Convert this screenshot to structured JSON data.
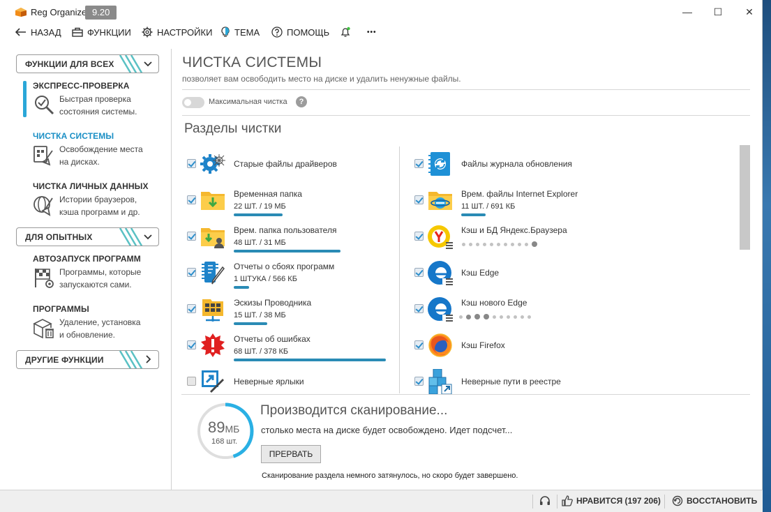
{
  "window": {
    "app_title": "Reg Organizer",
    "version": "9.20",
    "controls": {
      "minimize": "—",
      "maximize": "☐",
      "close": "✕"
    }
  },
  "menu": {
    "back": "НАЗАД",
    "functions": "ФУНКЦИИ",
    "settings": "НАСТРОЙКИ",
    "theme": "ТЕМА",
    "help": "ПОМОЩЬ",
    "more": "•••"
  },
  "sidebar": {
    "groups": [
      {
        "label": "ФУНКЦИИ ДЛЯ ВСЕХ"
      },
      {
        "label": "ДЛЯ ОПЫТНЫХ"
      },
      {
        "label": "ДРУГИЕ ФУНКЦИИ"
      }
    ],
    "items": [
      {
        "title": "ЭКСПРЕСС-ПРОВЕРКА",
        "line1": "Быстрая проверка",
        "line2": "состояния системы."
      },
      {
        "title": "ЧИСТКА СИСТЕМЫ",
        "line1": "Освобождение места",
        "line2": "на дисках."
      },
      {
        "title": "ЧИСТКА ЛИЧНЫХ ДАННЫХ",
        "line1": "Истории браузеров,",
        "line2": "кэша программ и др."
      },
      {
        "title": "АВТОЗАПУСК ПРОГРАММ",
        "line1": "Программы, которые",
        "line2": "запускаются сами."
      },
      {
        "title": "ПРОГРАММЫ",
        "line1": "Удаление, установка",
        "line2": "и обновление."
      }
    ]
  },
  "main": {
    "title": "ЧИСТКА СИСТЕМЫ",
    "subtitle": "позволяет вам освободить место на диске и удалить ненужные файлы.",
    "max_clean_label": "Максимальная чистка",
    "help_glyph": "?",
    "sections_title": "Разделы чистки",
    "left_rows": [
      {
        "name": "Старые файлы драйверов",
        "info": "",
        "progress": 0,
        "checked": true
      },
      {
        "name": "Временная папка",
        "info": "22 ШТ. / 19 МБ",
        "progress": 0.32,
        "checked": true
      },
      {
        "name": "Врем. папка пользователя",
        "info": "48 ШТ. / 31 МБ",
        "progress": 0.7,
        "checked": true
      },
      {
        "name": "Отчеты о сбоях программ",
        "info": "1 ШТУКА / 566 КБ",
        "progress": 0.1,
        "checked": true
      },
      {
        "name": "Эскизы Проводника",
        "info": "15 ШТ. / 38 МБ",
        "progress": 0.22,
        "checked": true
      },
      {
        "name": "Отчеты об ошибках",
        "info": "68 ШТ. / 378 КБ",
        "progress": 1.0,
        "checked": true
      },
      {
        "name": "Неверные ярлыки",
        "info": "",
        "progress": 0,
        "checked": false
      }
    ],
    "right_rows": [
      {
        "name": "Файлы журнала обновления",
        "info": "",
        "checked": true
      },
      {
        "name": "Врем. файлы Internet Explorer",
        "info": "11 ШТ. / 691 КБ",
        "progress": 0.16,
        "checked": true
      },
      {
        "name": "Кэш и БД Яндекс.Браузера",
        "info": "",
        "checked": true,
        "scanning": true
      },
      {
        "name": "Кэш Edge",
        "info": "",
        "checked": true
      },
      {
        "name": "Кэш нового Edge",
        "info": "",
        "checked": true,
        "scanning": true
      },
      {
        "name": "Кэш Firefox",
        "info": "",
        "checked": true
      },
      {
        "name": "Неверные пути в реестре",
        "info": "",
        "checked": true
      }
    ]
  },
  "scan": {
    "size_value": "89",
    "size_unit": "МБ",
    "count": "168 шт.",
    "progress": 0.45,
    "title": "Производится сканирование...",
    "subtitle": "столько места на диске будет освобождено. Идет подсчет...",
    "stop_label": "ПРЕРВАТЬ",
    "note": "Сканирование раздела немного затянулось, но скоро будет завершено."
  },
  "statusbar": {
    "like": "НРАВИТСЯ (197 206)",
    "restore": "ВОССТАНОВИТЬ"
  },
  "colors": {
    "accent": "#1a8fc5",
    "bar": "#2a8bb5",
    "ring": "#2ab0e4"
  }
}
